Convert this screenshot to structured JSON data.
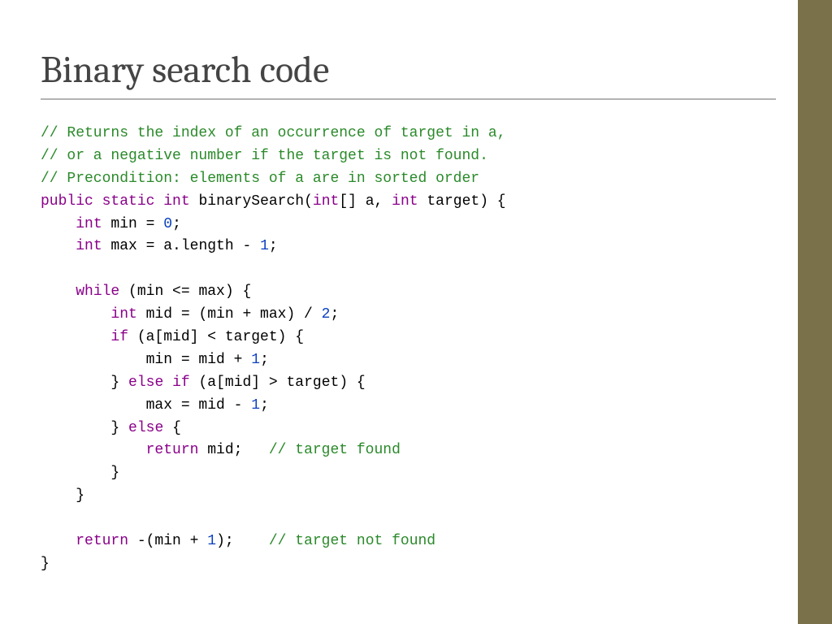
{
  "title": "Binary search code",
  "code": {
    "comment1": "// Returns the index of an occurrence of target in a,",
    "comment2": "// or a negative number if the target is not found.",
    "comment3": "// Precondition: elements of a are in sorted order",
    "kw_public": "public",
    "kw_static": "static",
    "kw_int": "int",
    "fn_name": "binarySearch",
    "paren_open": "(",
    "brackets": "[]",
    "param_a": "a",
    "comma_sp": ", ",
    "param_target": "target",
    "paren_close_brace": ") {",
    "decl_min": " min = ",
    "zero": "0",
    "semi": ";",
    "decl_max": " max = a.length - ",
    "one": "1",
    "kw_while": "while",
    "while_cond": " (min <= max) {",
    "decl_mid_lhs": " mid = (min + max) / ",
    "two": "2",
    "kw_if": "if",
    "if_cond1": " (a[mid] < target) {",
    "stmt_min": "min = mid + ",
    "brace_close": "}",
    "kw_else": "else",
    "if_cond2": " (a[mid] > target) {",
    "stmt_max": "max = mid - ",
    "else_brace": " {",
    "kw_return": "return",
    "ret_mid": " mid;   ",
    "cmt_found": "// target found",
    "ret_neg": " -(min + ",
    "ret_tail": ");    ",
    "cmt_notfound": "// target not found",
    "brace": "}"
  }
}
